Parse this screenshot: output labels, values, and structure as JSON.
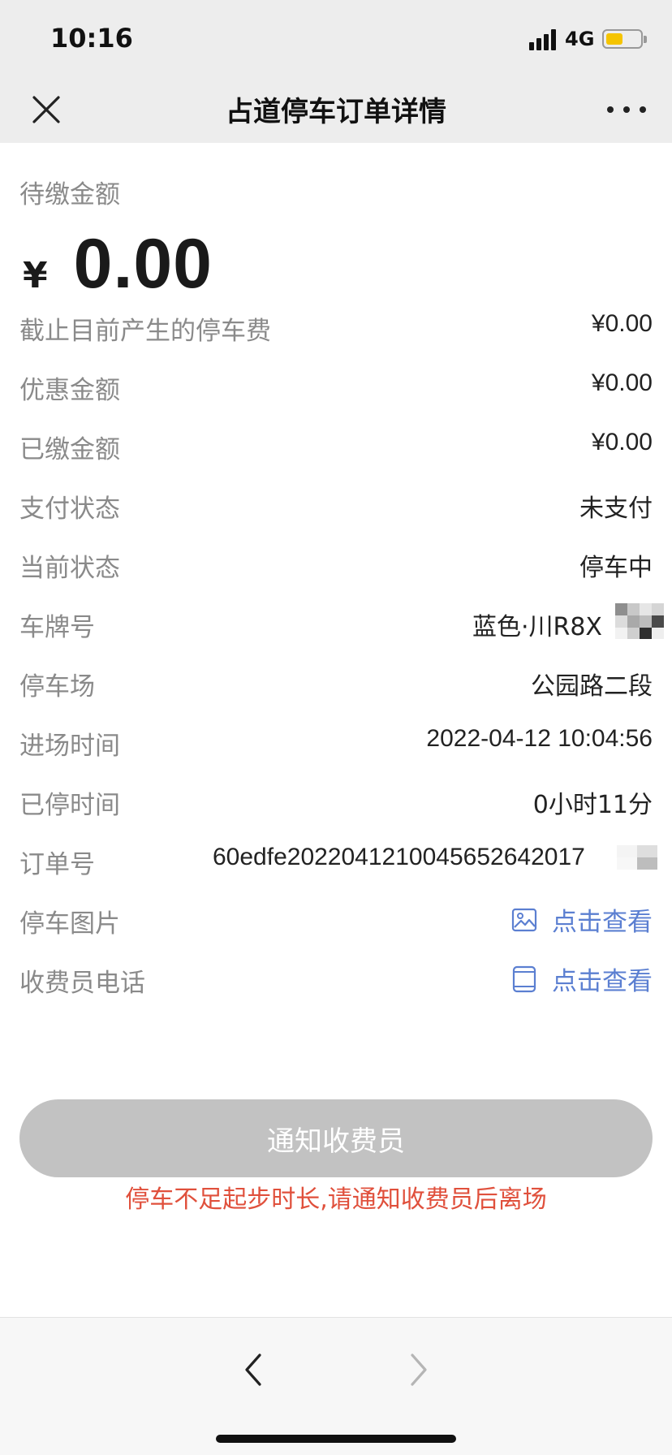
{
  "status_bar": {
    "time": "10:16",
    "network": "4G"
  },
  "nav": {
    "title": "占道停车订单详情"
  },
  "due": {
    "label": "待缴金额",
    "currency": "¥",
    "value": "0.00"
  },
  "rows": [
    {
      "label": "截止目前产生的停车费",
      "value": "¥0.00"
    },
    {
      "label": "优惠金额",
      "value": "¥0.00"
    },
    {
      "label": "已缴金额",
      "value": "¥0.00"
    },
    {
      "label": "支付状态",
      "value": "未支付"
    },
    {
      "label": "当前状态",
      "value": "停车中"
    },
    {
      "label": "车牌号",
      "value": "蓝色·川R8X"
    },
    {
      "label": "停车场",
      "value": "公园路二段"
    },
    {
      "label": "进场时间",
      "value": "2022-04-12 10:04:56"
    },
    {
      "label": "已停时间",
      "value": "0小时11分"
    },
    {
      "label": "订单号",
      "value": "60edfe2022041210045652642017"
    },
    {
      "label": "停车图片",
      "value": "点击查看",
      "icon": "image-icon"
    },
    {
      "label": "收费员电话",
      "value": "点击查看",
      "icon": "phone-icon"
    }
  ],
  "actions": {
    "notify_label": "通知收费员",
    "hint": "停车不足起步时长,请通知收费员后离场"
  },
  "colors": {
    "link": "#5b7fd1",
    "hint": "#e0503c",
    "button_disabled": "#c2c2c2"
  }
}
